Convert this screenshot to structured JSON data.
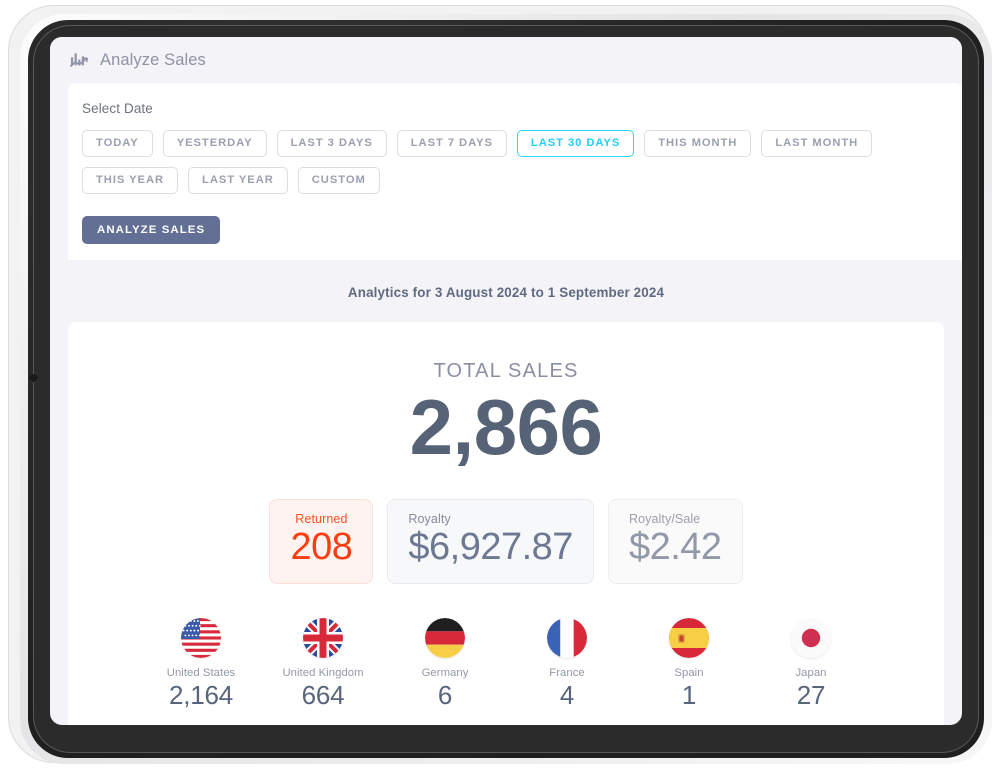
{
  "header": {
    "icon": "analytics-bar-chart-icon",
    "title": "Analyze Sales"
  },
  "date_panel": {
    "label": "Select Date",
    "chips": [
      {
        "label": "TODAY",
        "active": false
      },
      {
        "label": "YESTERDAY",
        "active": false
      },
      {
        "label": "LAST 3 DAYS",
        "active": false
      },
      {
        "label": "LAST 7 DAYS",
        "active": false
      },
      {
        "label": "LAST 30 DAYS",
        "active": true
      },
      {
        "label": "THIS MONTH",
        "active": false
      },
      {
        "label": "LAST MONTH",
        "active": false
      },
      {
        "label": "THIS YEAR",
        "active": false
      },
      {
        "label": "LAST YEAR",
        "active": false
      },
      {
        "label": "CUSTOM",
        "active": false
      }
    ],
    "submit_label": "ANALYZE SALES",
    "active_chip_color": "#24cdf2",
    "submit_color": "#636f95"
  },
  "report": {
    "range_title": "Analytics for 3 August 2024 to 1 September 2024",
    "total_label": "TOTAL SALES",
    "total_value": "2,866",
    "metrics": [
      {
        "label": "Returned",
        "value": "208",
        "color": "#fc3d11"
      },
      {
        "label": "Royalty",
        "value": "$6,927.87",
        "color": "#6d7892"
      },
      {
        "label": "Royalty/Sale",
        "value": "$2.42",
        "color": "#9198a8"
      }
    ],
    "countries": [
      {
        "flag": "flag-united-states",
        "name": "United States",
        "value": "2,164"
      },
      {
        "flag": "flag-united-kingdom",
        "name": "United Kingdom",
        "value": "664"
      },
      {
        "flag": "flag-germany",
        "name": "Germany",
        "value": "6"
      },
      {
        "flag": "flag-france",
        "name": "France",
        "value": "4"
      },
      {
        "flag": "flag-spain",
        "name": "Spain",
        "value": "1"
      },
      {
        "flag": "flag-japan",
        "name": "Japan",
        "value": "27"
      }
    ]
  }
}
